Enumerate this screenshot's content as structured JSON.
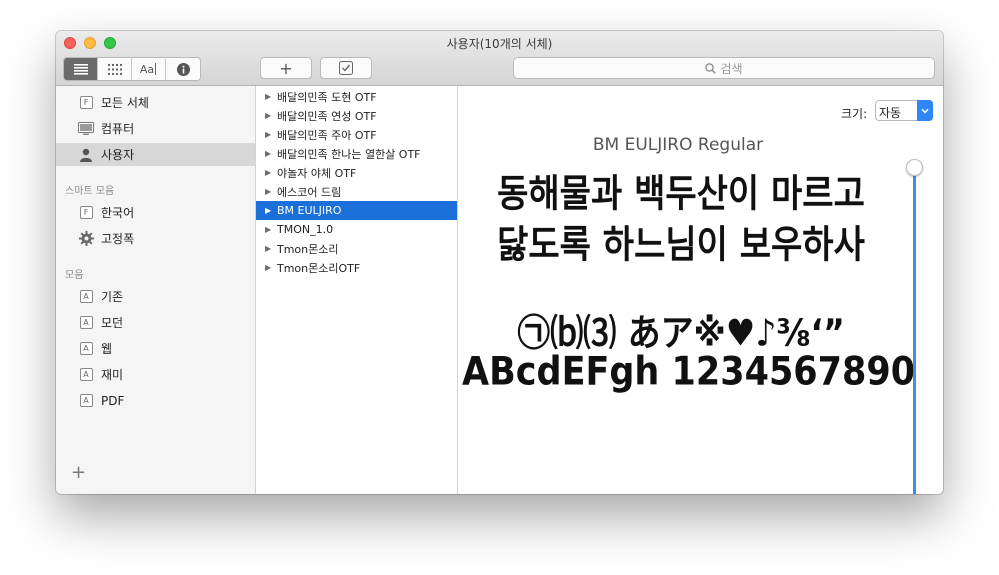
{
  "window": {
    "title": "사용자(10개의 서체)"
  },
  "toolbar": {
    "view_aa": "Aa",
    "add_label": "+",
    "search_placeholder": "검색"
  },
  "sidebar": {
    "library_items": [
      {
        "label": "모든 서체",
        "icon": "font-file-icon"
      },
      {
        "label": "컴퓨터",
        "icon": "computer-icon"
      },
      {
        "label": "사용자",
        "icon": "user-icon"
      }
    ],
    "smart_heading": "스마트 모음",
    "smart_items": [
      {
        "label": "한국어",
        "icon": "font-file-icon"
      },
      {
        "label": "고정폭",
        "icon": "gear-icon"
      }
    ],
    "collections_heading": "모음",
    "collection_items": [
      {
        "label": "기존",
        "icon": "collection-icon"
      },
      {
        "label": "모던",
        "icon": "collection-icon"
      },
      {
        "label": "웹",
        "icon": "collection-icon"
      },
      {
        "label": "재미",
        "icon": "collection-icon"
      },
      {
        "label": "PDF",
        "icon": "collection-icon"
      }
    ],
    "add_collection": "+"
  },
  "fonts": [
    "배달의민족 도현 OTF",
    "배달의민족 연성 OTF",
    "배달의민족 주아 OTF",
    "배달의민족 한나는 열한살 OTF",
    "야놀자 야체 OTF",
    "에스코어 드림",
    "BM EULJIRO",
    "TMON_1.0",
    "Tmon몬소리",
    "Tmon몬소리OTF"
  ],
  "preview": {
    "size_label": "크기:",
    "size_value": "자동",
    "font_title": "BM EULJIRO Regular",
    "sample_line1": "동해물과 백두산이 마르고",
    "sample_line2": "닳도록 하느님이 보우하사",
    "sample_line3": "㉠⒝⑶ あア※♥♪⅜‘”",
    "sample_line4": "ABcdEFgh 1234567890"
  },
  "colors": {
    "accent": "#1a6fd8",
    "selection_sidebar": "#d7d7d7",
    "slider": "#3c8ee8"
  }
}
